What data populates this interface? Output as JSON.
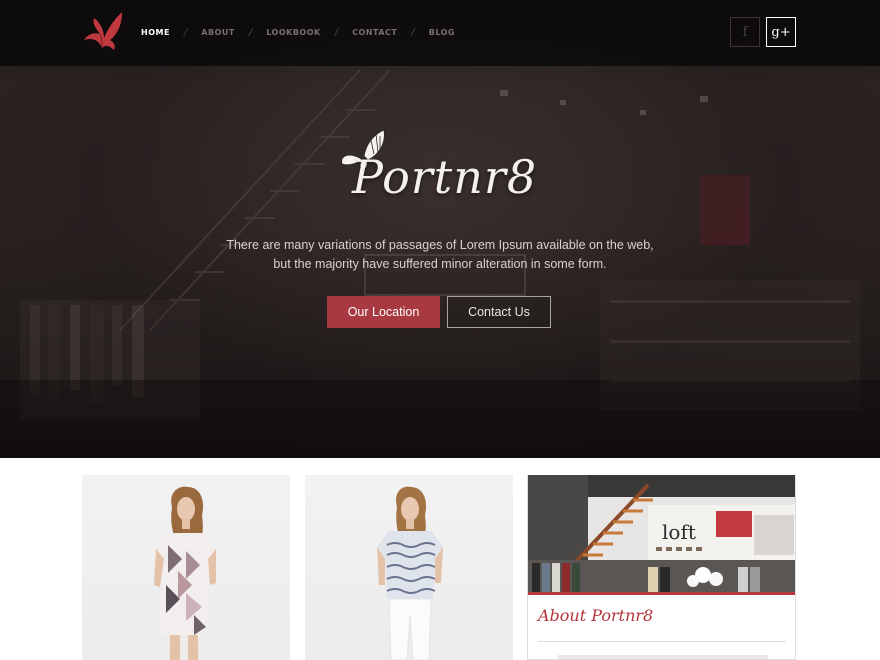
{
  "nav": {
    "items": [
      {
        "label": "HOME",
        "active": true
      },
      {
        "label": "ABOUT",
        "active": false
      },
      {
        "label": "LOOKBOOK",
        "active": false
      },
      {
        "label": "CONTACT",
        "active": false
      },
      {
        "label": "BLOG",
        "active": false
      }
    ],
    "separator": "/"
  },
  "social": {
    "facebook_glyph": "f",
    "googleplus_glyph": "g+"
  },
  "hero": {
    "brand": "Portnr8",
    "tagline_line1": "There are many variations of passages of Lorem Ipsum available on the web,",
    "tagline_line2": "but the majority have suffered minor alteration in some form.",
    "primary_button": "Our Location",
    "secondary_button": "Contact Us"
  },
  "about": {
    "title": "About Portnr8"
  },
  "colors": {
    "accent": "#a93940",
    "nav_active": "#ffffff",
    "nav_inactive": "#77706e",
    "about_title": "#b3343a"
  },
  "icons": {
    "logo": "butterfly-logo",
    "brand_ornament": "butterfly-icon",
    "facebook": "facebook-icon",
    "googleplus": "google-plus-icon"
  }
}
